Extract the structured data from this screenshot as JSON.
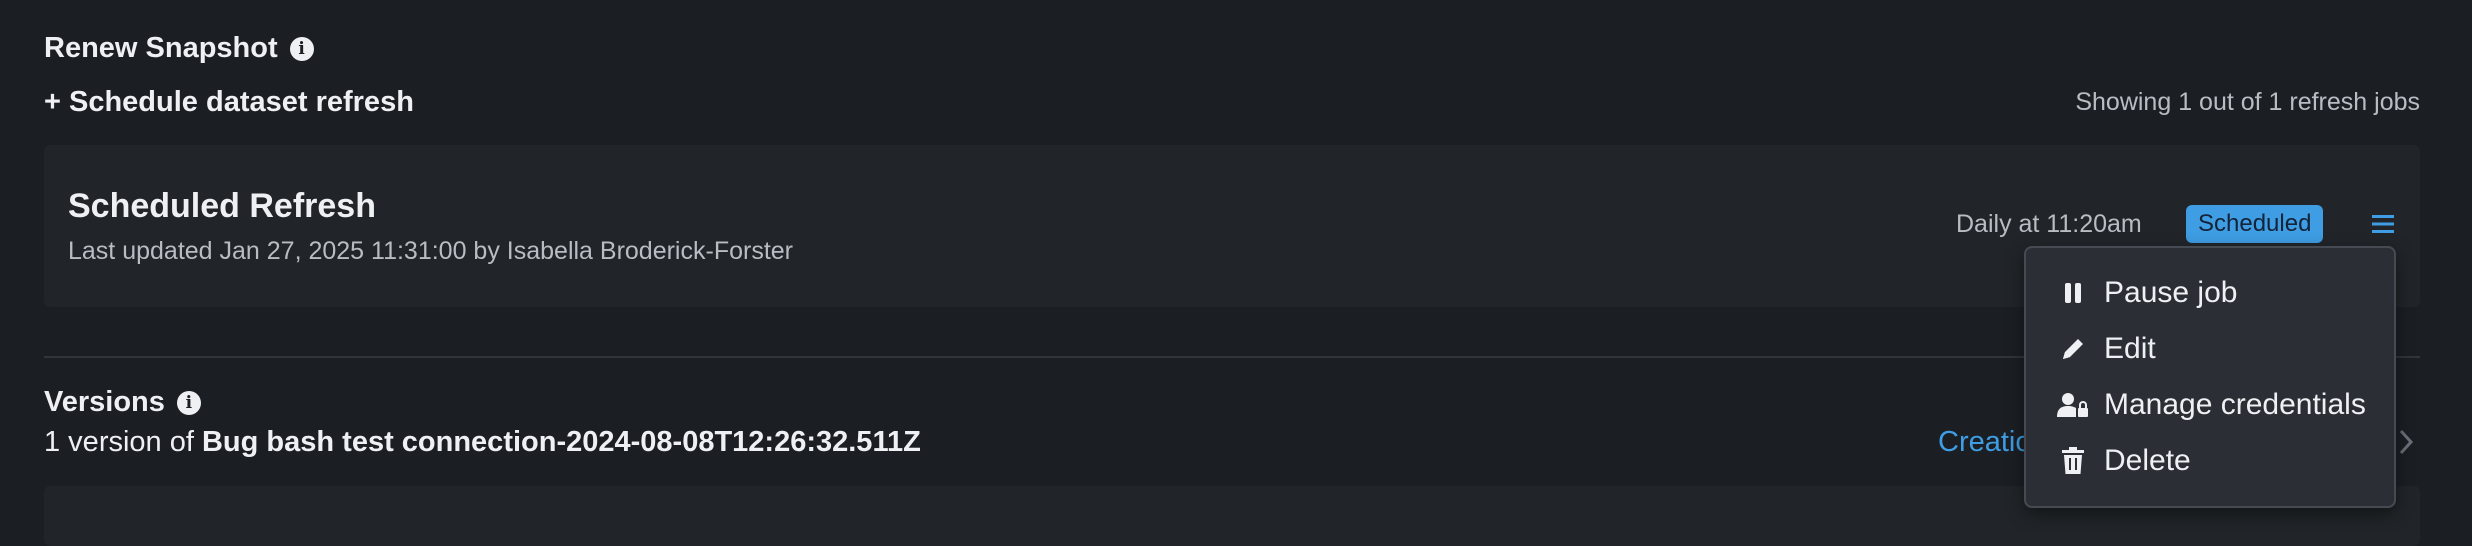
{
  "renew": {
    "title": "Renew Snapshot"
  },
  "schedule": {
    "button_label": "+ Schedule dataset refresh"
  },
  "jobs_count": {
    "text": "Showing 1 out of 1 refresh jobs"
  },
  "job_card": {
    "title": "Scheduled Refresh",
    "updated": "Last updated Jan 27, 2025 11:31:00 by Isabella Broderick-Forster",
    "schedule_text": "Daily at 11:20am",
    "status_badge": "Scheduled"
  },
  "menu": {
    "items": [
      {
        "label": "Pause job",
        "icon": "pause-icon"
      },
      {
        "label": "Edit",
        "icon": "pencil-icon"
      },
      {
        "label": "Manage credentials",
        "icon": "user-lock-icon"
      },
      {
        "label": "Delete",
        "icon": "trash-icon"
      }
    ]
  },
  "versions": {
    "title": "Versions",
    "prefix": "1 version of ",
    "dataset_name": "Bug bash test connection-2024-08-08T12:26:32.511Z",
    "link_partial": "Creatio"
  },
  "colors": {
    "background": "#1b1f24",
    "card": "#212529",
    "accent": "#3e9de3"
  }
}
